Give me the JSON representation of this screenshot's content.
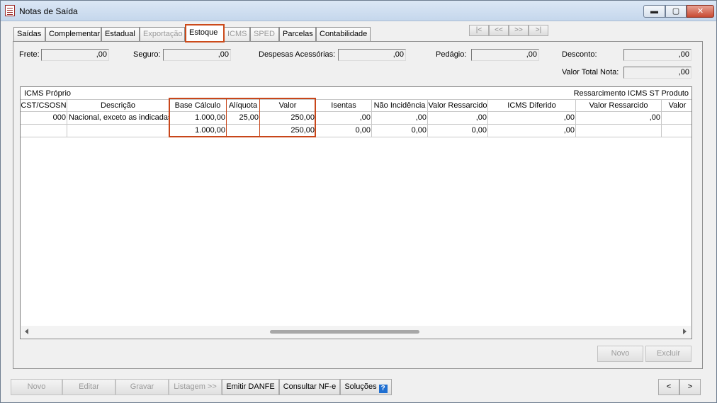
{
  "window": {
    "title": "Notas de Saída",
    "controls": {
      "minimize": "▬",
      "maximize": "▢",
      "close": "✕"
    }
  },
  "tabs": [
    {
      "label": "Saídas",
      "state": "normal"
    },
    {
      "label": "Complementar",
      "state": "normal"
    },
    {
      "label": "Estadual",
      "state": "normal"
    },
    {
      "label": "Exportação",
      "state": "disabled"
    },
    {
      "label": "Estoque",
      "state": "active"
    },
    {
      "label": "ICMS",
      "state": "disabled"
    },
    {
      "label": "SPED",
      "state": "disabled"
    },
    {
      "label": "Parcelas",
      "state": "normal"
    },
    {
      "label": "Contabilidade",
      "state": "normal"
    }
  ],
  "record_nav": {
    "first": "|<",
    "prev": "<<",
    "next": ">>",
    "last": ">|"
  },
  "fields": {
    "frete": {
      "label": "Frete:",
      "value": ",00"
    },
    "seguro": {
      "label": "Seguro:",
      "value": ",00"
    },
    "despesas": {
      "label": "Despesas Acessórias:",
      "value": ",00"
    },
    "pedagio": {
      "label": "Pedágio:",
      "value": ",00"
    },
    "desconto": {
      "label": "Desconto:",
      "value": ",00"
    },
    "valor_total": {
      "label": "Valor Total Nota:",
      "value": ",00"
    }
  },
  "grid": {
    "group_left": "ICMS Próprio",
    "group_right": "Ressarcimento ICMS ST  Produto",
    "columns": [
      "CST/CSOSN",
      "Descrição",
      "Base Cálculo",
      "Alíquota",
      "Valor",
      "Isentas",
      "Não Incidência",
      "Valor Ressarcido",
      "ICMS Diferido",
      "Valor Ressarcido",
      "Valor"
    ],
    "rows": [
      [
        "000",
        "Nacional, exceto as indicadas",
        "1.000,00",
        "25,00",
        "250,00",
        ",00",
        ",00",
        ",00",
        ",00",
        ",00",
        ""
      ],
      [
        "",
        "",
        "1.000,00",
        "",
        "250,00",
        "0,00",
        "0,00",
        "0,00",
        ",00",
        "",
        ""
      ]
    ]
  },
  "panel_buttons": {
    "novo": "Novo",
    "excluir": "Excluir"
  },
  "bottom_buttons": {
    "novo": "Novo",
    "editar": "Editar",
    "gravar": "Gravar",
    "listagem": "Listagem >>",
    "emitir": "Emitir DANFE",
    "consultar": "Consultar NF-e",
    "solucoes": "Soluções",
    "prev": "<",
    "next": ">"
  }
}
